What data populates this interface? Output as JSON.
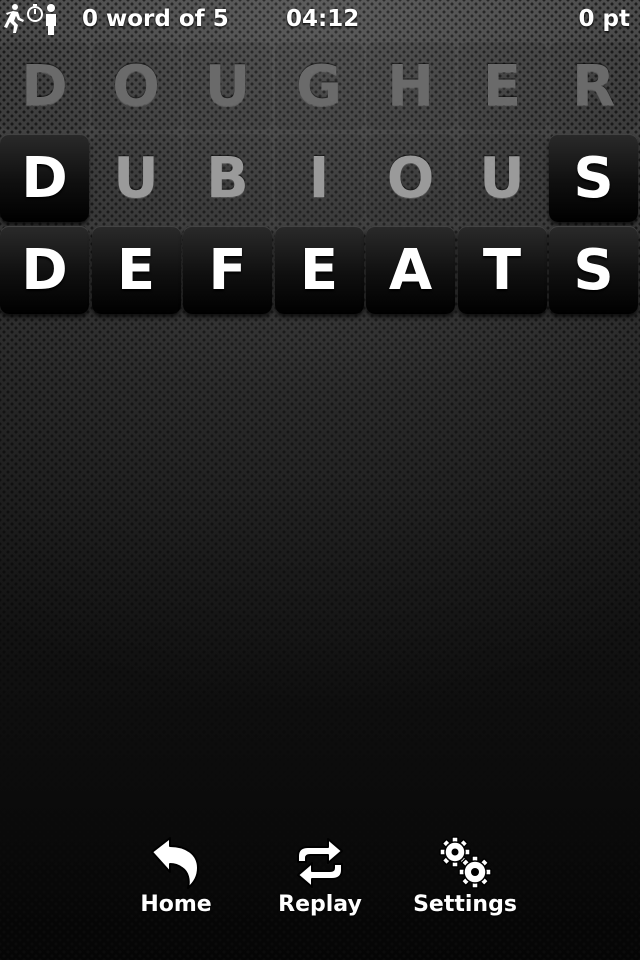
{
  "status": {
    "words_count": "0 word of 5",
    "timer": "04:12",
    "score": "0 pt",
    "icons": [
      "runner-icon",
      "stopwatch-icon",
      "person-icon"
    ]
  },
  "board": {
    "rows": [
      {
        "word": "DOUGHER",
        "tiles": [
          {
            "letter": "D",
            "style": "ghost"
          },
          {
            "letter": "O",
            "style": "ghost"
          },
          {
            "letter": "U",
            "style": "ghost"
          },
          {
            "letter": "G",
            "style": "ghost"
          },
          {
            "letter": "H",
            "style": "ghost"
          },
          {
            "letter": "E",
            "style": "ghost"
          },
          {
            "letter": "R",
            "style": "ghost"
          }
        ]
      },
      {
        "word": "DUBIOUS",
        "tiles": [
          {
            "letter": "D",
            "style": "solid"
          },
          {
            "letter": "U",
            "style": "ghost-light"
          },
          {
            "letter": "B",
            "style": "ghost-light"
          },
          {
            "letter": "I",
            "style": "ghost-light"
          },
          {
            "letter": "O",
            "style": "ghost-light"
          },
          {
            "letter": "U",
            "style": "ghost-light"
          },
          {
            "letter": "S",
            "style": "solid"
          }
        ]
      },
      {
        "word": "DEFEATS",
        "tiles": [
          {
            "letter": "D",
            "style": "solid"
          },
          {
            "letter": "E",
            "style": "solid"
          },
          {
            "letter": "F",
            "style": "solid"
          },
          {
            "letter": "E",
            "style": "solid"
          },
          {
            "letter": "A",
            "style": "solid"
          },
          {
            "letter": "T",
            "style": "solid"
          },
          {
            "letter": "S",
            "style": "solid"
          }
        ]
      }
    ]
  },
  "toolbar": {
    "home_label": "Home",
    "replay_label": "Replay",
    "settings_label": "Settings",
    "home_icon": "undo-arrow-icon",
    "replay_icon": "repeat-icon",
    "settings_icon": "gears-icon"
  }
}
